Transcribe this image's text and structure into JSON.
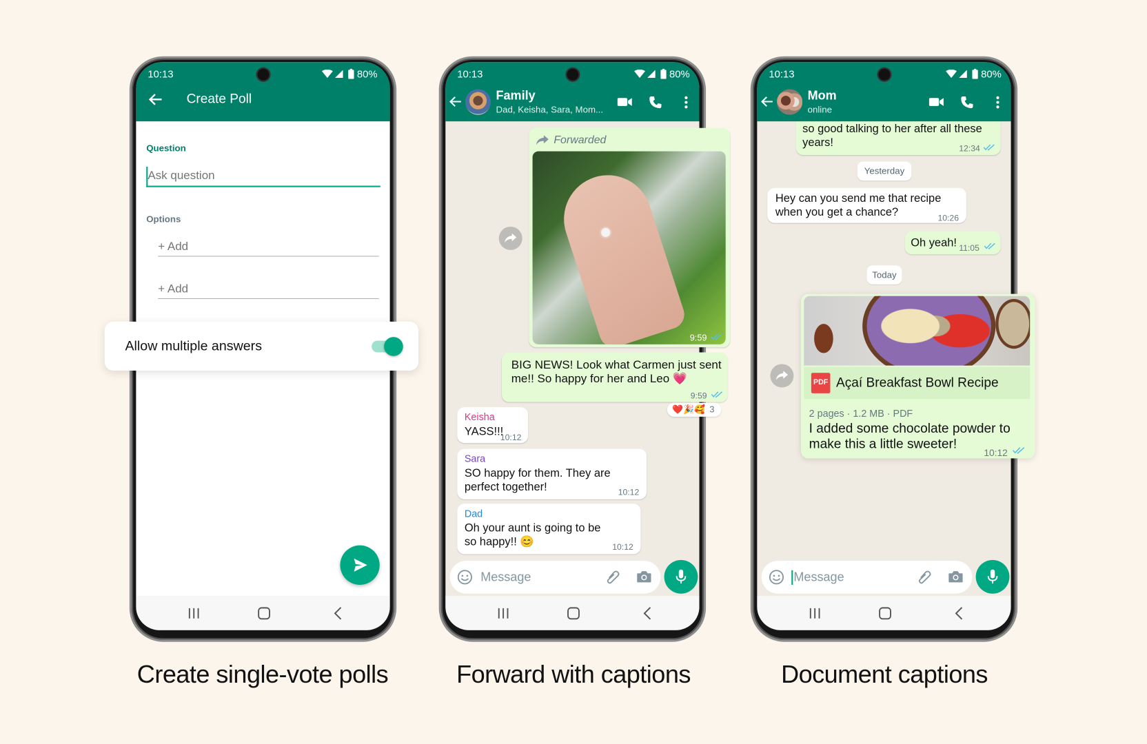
{
  "background_color": "#fcf5eb",
  "accent_color": "#008069",
  "poll": {
    "status": {
      "time": "10:13",
      "battery": "80%"
    },
    "title": "Create Poll",
    "question_label": "Question",
    "question_placeholder": "Ask question",
    "options_label": "Options",
    "options": [
      {
        "placeholder": "+ Add"
      },
      {
        "placeholder": "+ Add"
      }
    ],
    "toggle": {
      "label": "Allow multiple answers",
      "on": true
    },
    "send_icon": "send-icon"
  },
  "family": {
    "status": {
      "time": "10:13",
      "battery": "80%"
    },
    "chat_name": "Family",
    "chat_subtitle": "Dad, Keisha, Sara, Mom...",
    "forwarded_label": "Forwarded",
    "image_time": "9:59",
    "own_message": {
      "text": "BIG NEWS! Look what Carmen just sent me!! So happy for her and Leo 💗",
      "time": "9:59"
    },
    "reactions": {
      "emojis": "❤️🎉🥰",
      "count": "3"
    },
    "messages": [
      {
        "sender": "Keisha",
        "color": "#e0338f",
        "text": "YASS!!!",
        "time": "10:12"
      },
      {
        "sender": "Sara",
        "color": "#7b3fd6",
        "text": "SO happy for them. They are perfect together!",
        "time": "10:12"
      },
      {
        "sender": "Dad",
        "color": "#1e88e5",
        "text": "Oh your aunt is going to be so happy!! 😊",
        "time": "10:12"
      }
    ],
    "input_placeholder": "Message"
  },
  "mom": {
    "status": {
      "time": "10:13",
      "battery": "80%"
    },
    "chat_name": "Mom",
    "chat_subtitle": "online",
    "messages": [
      {
        "text": "so good talking to her after all these years!",
        "time": "12:34"
      },
      {
        "divider": "Yesterday"
      },
      {
        "text": "Hey can you send me that recipe when you get a chance?",
        "time": "10:26"
      },
      {
        "text": "Oh yeah!",
        "time": "11:05"
      },
      {
        "divider": "Today"
      }
    ],
    "document": {
      "badge": "PDF",
      "title": "Açaí Breakfast Bowl Recipe",
      "meta": "2 pages · 1.2 MB · PDF",
      "caption": "I added some chocolate powder to make this a little sweeter!",
      "time": "10:12"
    },
    "input_placeholder": "Message"
  },
  "captions": [
    "Create single-vote polls",
    "Forward with captions",
    "Document captions"
  ]
}
